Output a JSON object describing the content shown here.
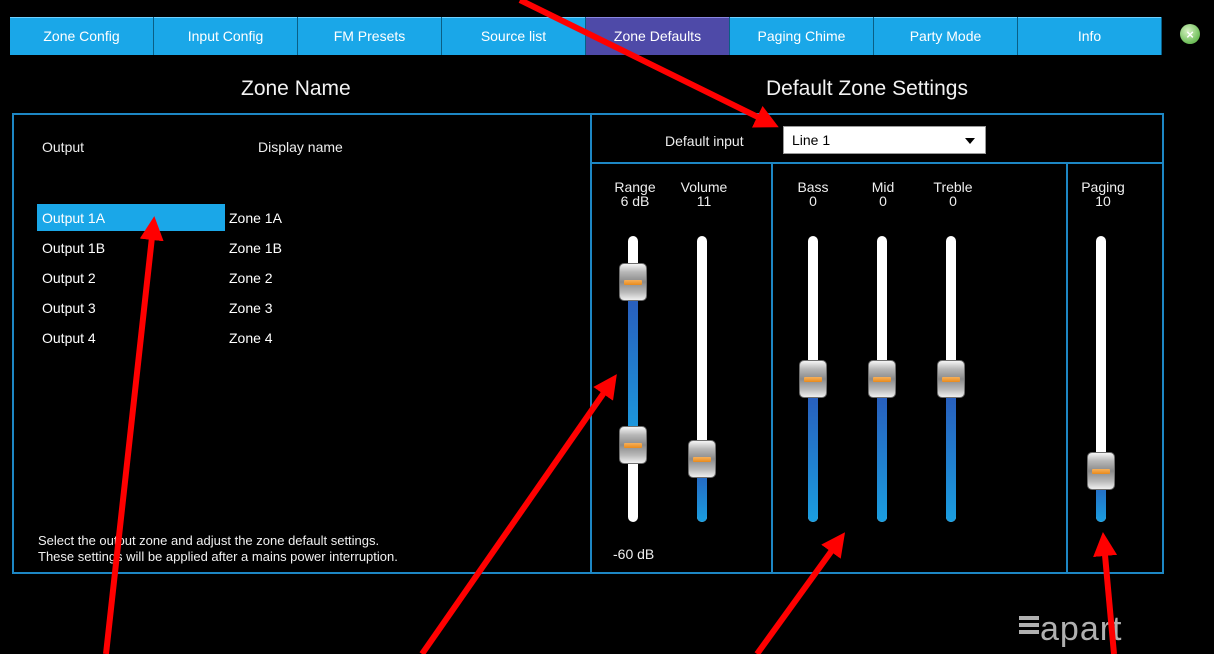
{
  "tabs": [
    {
      "label": "Zone Config"
    },
    {
      "label": "Input Config"
    },
    {
      "label": "FM Presets"
    },
    {
      "label": "Source list"
    },
    {
      "label": "Zone Defaults",
      "active": true
    },
    {
      "label": "Paging Chime"
    },
    {
      "label": "Party Mode"
    },
    {
      "label": "Info"
    }
  ],
  "left": {
    "title": "Zone Name",
    "col_output": "Output",
    "col_display": "Display name",
    "rows": [
      {
        "output": "Output 1A",
        "display": "Zone 1A",
        "selected": true
      },
      {
        "output": "Output 1B",
        "display": "Zone 1B"
      },
      {
        "output": "Output 2",
        "display": "Zone 2"
      },
      {
        "output": "Output 3",
        "display": "Zone 3"
      },
      {
        "output": "Output 4",
        "display": "Zone 4"
      }
    ],
    "help_line1": "Select the output zone and adjust the zone default settings.",
    "help_line2": "These settings will be applied after a mains power interruption."
  },
  "right": {
    "title": "Default Zone Settings",
    "default_input_label": "Default input",
    "default_input_value": "Line 1",
    "range": {
      "label": "Range",
      "value": "6 dB",
      "min_label": "-60 dB",
      "upper_level": 0.84,
      "lower_level": 0.27
    },
    "volume": {
      "label": "Volume",
      "value": "11",
      "level": 0.22
    },
    "bass": {
      "label": "Bass",
      "value": "0",
      "level": 0.5
    },
    "mid": {
      "label": "Mid",
      "value": "0",
      "level": 0.5
    },
    "treble": {
      "label": "Treble",
      "value": "0",
      "level": 0.5
    },
    "paging": {
      "label": "Paging",
      "value": "10",
      "level": 0.18
    }
  },
  "logo": {
    "text": "apart"
  },
  "colors": {
    "accent": "#1aa7e8",
    "active_tab": "#4e4aa8",
    "frame": "#1d87c4",
    "annotation": "#ff0000"
  }
}
